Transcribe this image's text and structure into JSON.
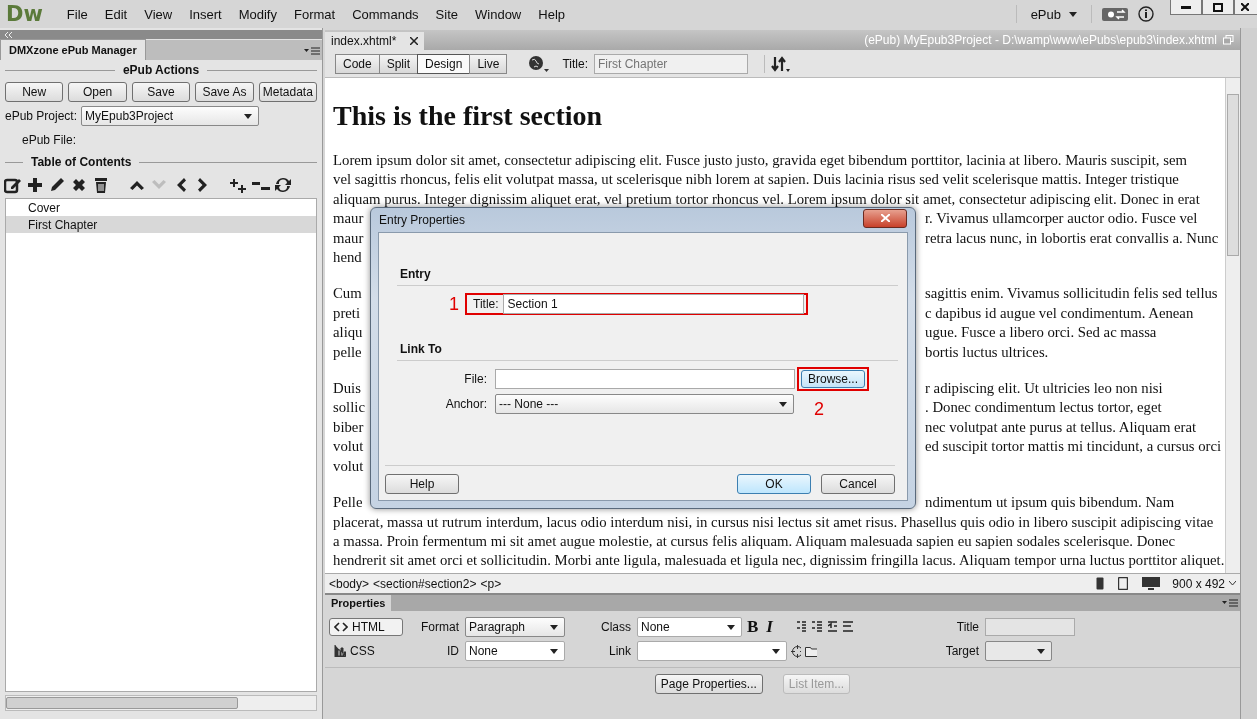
{
  "app": {
    "logo": "Dw",
    "workspace": "ePub"
  },
  "menu": [
    "File",
    "Edit",
    "View",
    "Insert",
    "Modify",
    "Format",
    "Commands",
    "Site",
    "Window",
    "Help"
  ],
  "panel": {
    "tab": "DMXzone ePub Manager",
    "actions_heading": "ePub Actions",
    "buttons": [
      "New",
      "Open",
      "Save",
      "Save As",
      "Metadata"
    ],
    "project_label": "ePub Project:",
    "project": "MyEpub3Project",
    "file_label": "ePub File:",
    "toc_heading": "Table of Contents",
    "toc_tools": [
      {
        "kind": "compose",
        "disabled": false
      },
      {
        "kind": "plus",
        "disabled": false
      },
      {
        "kind": "pencil",
        "disabled": false
      },
      {
        "kind": "cross",
        "disabled": false
      },
      {
        "kind": "trash",
        "disabled": false
      },
      {
        "kind": "up",
        "disabled": false
      },
      {
        "kind": "down",
        "disabled": true
      },
      {
        "kind": "left",
        "disabled": false
      },
      {
        "kind": "right",
        "disabled": false
      },
      {
        "kind": "addchild",
        "disabled": false
      },
      {
        "kind": "minus",
        "disabled": false
      },
      {
        "kind": "refresh",
        "disabled": false
      }
    ],
    "toc": [
      {
        "label": "Cover",
        "selected": false
      },
      {
        "label": "First Chapter",
        "selected": true
      }
    ]
  },
  "document": {
    "tab": "index.xhtml*",
    "path": "(ePub) MyEpub3Project - D:\\wamp\\www\\ePubs\\epub3\\index.xhtml",
    "views": [
      {
        "label": "Code",
        "selected": false
      },
      {
        "label": "Split",
        "selected": false
      },
      {
        "label": "Design",
        "selected": true
      },
      {
        "label": "Live",
        "selected": false
      }
    ],
    "title_label": "Title:",
    "title_placeholder": "First Chapter",
    "heading": "This is the first section",
    "paragraphs": [
      {
        "lines": [
          {
            "text": "Lorem ipsum dolor sit amet, consectetur adipiscing elit. Fusce justo justo, gravida eget bibendum porttitor, lacinia at libero. Mauris suscipit, sem"
          },
          {
            "text": "vel sagittis rhoncus, felis elit volutpat massa, ut scelerisque nibh lorem at sapien. Duis lacinia risus sed velit scelerisque mattis. Integer tristique"
          },
          {
            "text": "aliquam purus. Integer dignissim aliquet erat, vel pretium tortor rhoncus vel. Lorem ipsum dolor sit amet, consectetur adipiscing elit. Donec in erat"
          },
          {
            "left": "maur",
            "right": "r. Vivamus ullamcorper auctor odio. Fusce vel"
          },
          {
            "left": "maur",
            "right": "retra lacus nunc, in lobortis erat convallis a. Nunc"
          },
          {
            "left": "hend"
          }
        ]
      },
      {
        "lines": [
          {
            "left": "Cum",
            "right": "sagittis enim. Vivamus sollicitudin felis sed tellus"
          },
          {
            "left": "preti",
            "right": "c dapibus id augue vel condimentum. Aenean"
          },
          {
            "left": "aliqu",
            "right": "ugue. Fusce a libero orci. Sed ac massa"
          },
          {
            "left": "pelle",
            "right": "bortis luctus ultrices."
          }
        ]
      },
      {
        "lines": [
          {
            "left": "Duis",
            "right": "r adipiscing elit. Ut ultricies leo non nisi"
          },
          {
            "left": "sollic",
            "right": ". Donec condimentum lectus tortor, eget"
          },
          {
            "left": "biber",
            "right": "nec volutpat ante purus at tellus. Aliquam erat"
          },
          {
            "left": "volut",
            "right": "ed suscipit tortor mattis mi tincidunt, a cursus orci"
          },
          {
            "left": "volut"
          }
        ]
      },
      {
        "lines": [
          {
            "left": "Pelle",
            "right": "ndimentum ut ipsum quis bibendum. Nam"
          },
          {
            "text": "placerat, massa ut rutrum interdum, lacus odio interdum nisi, in cursus nisi lectus sit amet risus. Phasellus quis odio in libero suscipit adipiscing vitae"
          },
          {
            "text": "a massa. Proin fermentum mi sit amet augue molestie, at cursus felis aliquam. Aliquam malesuada sapien eu sapien sodales scelerisque. Donec"
          },
          {
            "text": "hendrerit sit amet orci et sollicitudin. Morbi ante ligula, malesuada et ligula nec, dignissim fringilla lacus. Aliquam tempor urna luctus porttitor aliquet."
          }
        ]
      }
    ]
  },
  "status": {
    "tags": [
      "<body>",
      "<section#section2>",
      "<p>"
    ],
    "size": "900 x 492"
  },
  "dialog": {
    "title": "Entry Properties",
    "entry_heading": "Entry",
    "title_label": "Title:",
    "title_value": "Section 1",
    "callout_1": "1",
    "link_heading": "Link To",
    "file_label": "File:",
    "browse": "Browse...",
    "callout_2": "2",
    "anchor_label": "Anchor:",
    "anchor": "--- None ---",
    "buttons": [
      {
        "label": "Help",
        "default": false
      },
      {
        "label": "OK",
        "default": true
      },
      {
        "label": "Cancel",
        "default": false
      }
    ]
  },
  "properties": {
    "tab": "Properties",
    "modes": [
      {
        "label": "HTML",
        "kind": "html",
        "selected": true
      },
      {
        "label": "CSS",
        "kind": "css",
        "selected": false
      }
    ],
    "format_label": "Format",
    "format": "Paragraph",
    "id_label": "ID",
    "id": "None",
    "class_label": "Class",
    "class": "None",
    "link_label": "Link",
    "title_label": "Title",
    "target_label": "Target",
    "style_buttons": [
      "B",
      "I"
    ],
    "buttons": [
      {
        "label": "Page Properties...",
        "disabled": false
      },
      {
        "label": "List Item...",
        "disabled": true
      }
    ]
  }
}
